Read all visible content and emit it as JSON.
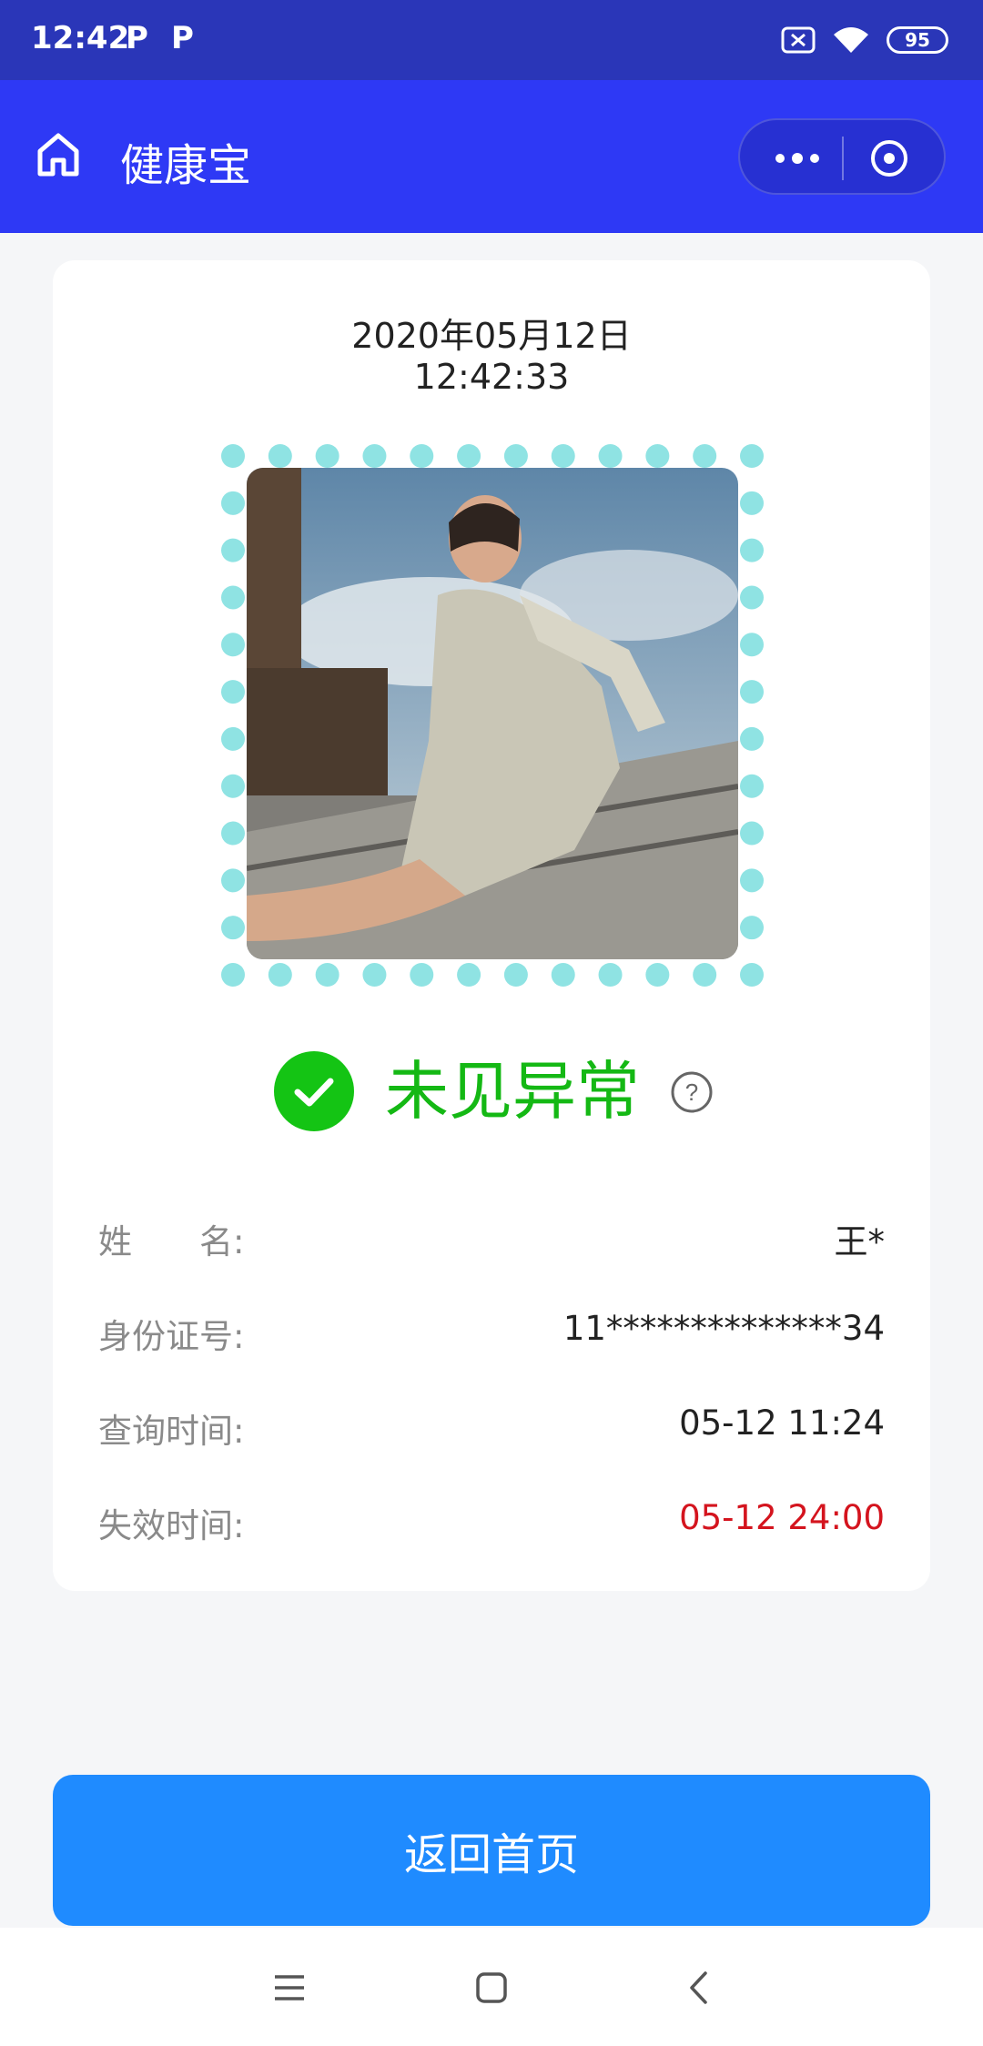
{
  "status_bar": {
    "time": "12:42",
    "notif_icons": [
      "P",
      "P"
    ],
    "battery": "95"
  },
  "app_bar": {
    "title": "健康宝"
  },
  "card": {
    "date": "2020年05月12日",
    "time": "12:42:33",
    "status": "未见异常",
    "fields": [
      {
        "label": "姓　　名:",
        "value": "王*"
      },
      {
        "label": "身份证号:",
        "value": "11**************34"
      },
      {
        "label": "查询时间:",
        "value": "05-12 11:24"
      },
      {
        "label": "失效时间:",
        "value": "05-12 24:00"
      }
    ]
  },
  "return_button": "返回首页",
  "colors": {
    "status_bar": "#2a36b8",
    "app_bar": "#2e39f5",
    "ok_green": "#14b814",
    "expire_red": "#d4141e",
    "button_blue": "#1f8bff",
    "dot_cyan": "#8fe3e3"
  }
}
